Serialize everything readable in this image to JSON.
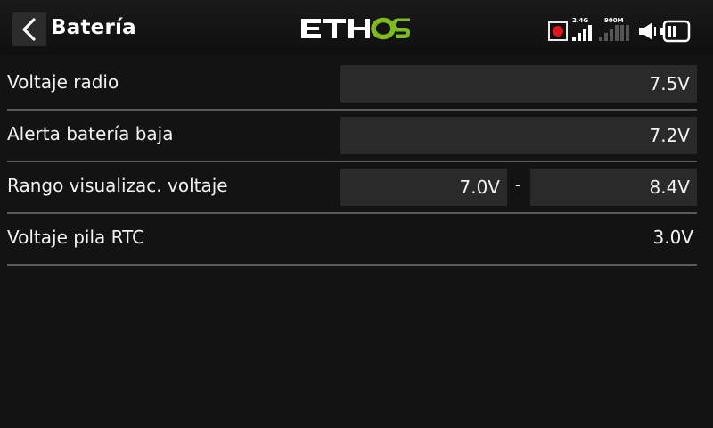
{
  "header": {
    "back_icon": "chevron-left-icon",
    "title": "Batería",
    "logo_text": "ETHOS",
    "status": {
      "record_icon": "record-icon",
      "rf1_label": "2.4G",
      "rf1_bars_active": 4,
      "rf2_label": "900M",
      "rf2_bars_active": 0,
      "speaker_icon": "speaker-icon",
      "battery_icon": "battery-icon",
      "battery_level_fraction": 0.4
    },
    "colors": {
      "logo_accent": "#7dbb1f",
      "record_dot": "#e0141b"
    }
  },
  "settings": [
    {
      "label": "Voltaje radio",
      "value": "7.5V"
    },
    {
      "label": "Alerta batería baja",
      "value": "7.2V"
    },
    {
      "label": "Rango visualizac. voltaje",
      "min_value": "7.0V",
      "separator": "-",
      "max_value": "8.4V"
    },
    {
      "label": "Voltaje pila RTC",
      "value": "3.0V"
    }
  ]
}
